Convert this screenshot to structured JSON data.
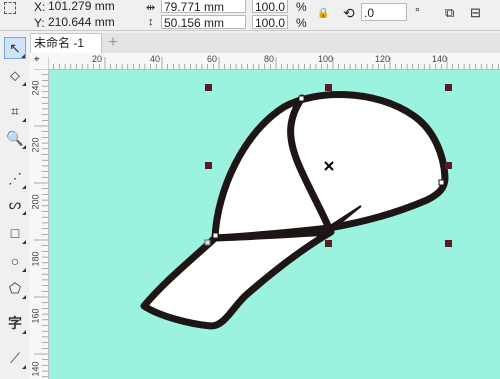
{
  "propbar": {
    "x_label": "X:",
    "x_value": "101.279 mm",
    "y_label": "Y:",
    "y_value": "210.644 mm",
    "width_value": "79.771 mm",
    "height_value": "50.156 mm",
    "scale_w": "100.0",
    "scale_h": "100.0",
    "percent_w": "%",
    "percent_h": "%",
    "rotation_value": ".0",
    "degree_symbol": "°"
  },
  "document": {
    "tab_name": "未命名 -1",
    "add_tab": "+"
  },
  "toolbox": {
    "text_tool_glyph": "字"
  },
  "ruler_top": {
    "labels": [
      "20",
      "40",
      "60",
      "80",
      "100",
      "120",
      "140"
    ]
  },
  "ruler_left": {
    "labels": [
      "240",
      "220",
      "200",
      "180",
      "160",
      "140"
    ]
  },
  "colors": {
    "canvas": "#9bf2df",
    "outline": "#1e1614",
    "fill": "#ffffff",
    "handle": "#5a1a24"
  }
}
